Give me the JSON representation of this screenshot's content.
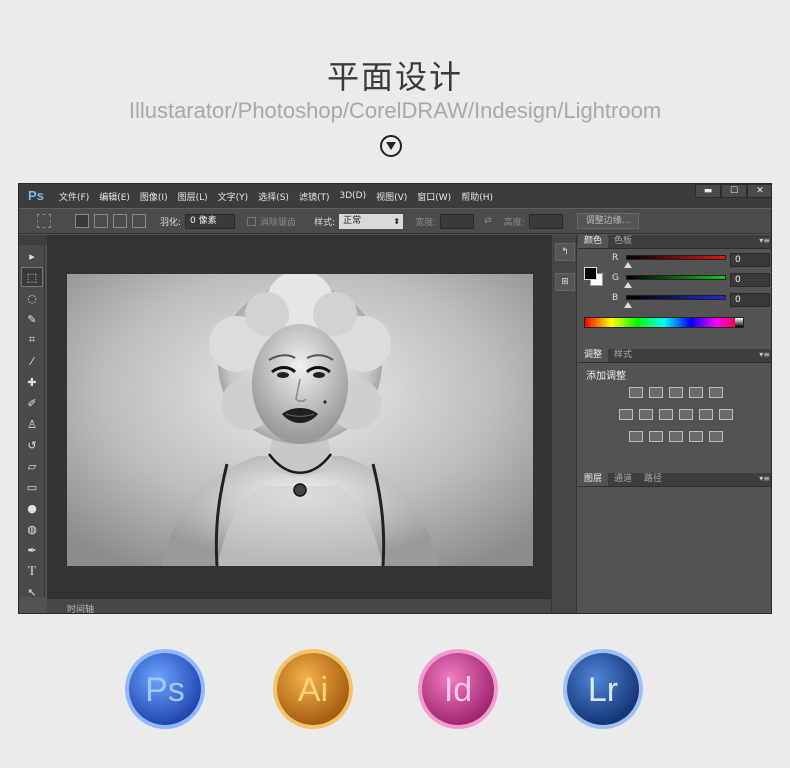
{
  "header": {
    "title": "平面设计",
    "subtitle": "Illustarator/Photoshop/CorelDRAW/Indesign/Lightroom"
  },
  "photoshop": {
    "logo": "Ps",
    "menu": [
      "文件(F)",
      "编辑(E)",
      "图像(I)",
      "图层(L)",
      "文字(Y)",
      "选择(S)",
      "滤镜(T)",
      "3D(D)",
      "视图(V)",
      "窗口(W)",
      "帮助(H)"
    ],
    "window_controls": [
      "▬",
      "☐",
      "✕"
    ],
    "options": {
      "feather_label": "羽化:",
      "feather_value": "0 像素",
      "antialias_label": "消除锯齿",
      "style_label": "样式:",
      "style_value": "正常",
      "width_label": "宽度:",
      "height_label": "高度:",
      "refine_button": "调整边缘..."
    },
    "timeline_label": "时间轴",
    "color_panel": {
      "tabs": [
        "颜色",
        "色板"
      ],
      "channels": [
        {
          "name": "R",
          "value": "0",
          "gradient": "#e11818"
        },
        {
          "name": "G",
          "value": "0",
          "gradient": "#18c818"
        },
        {
          "name": "B",
          "value": "0",
          "gradient": "#1830e0"
        }
      ]
    },
    "adjust_panel": {
      "tabs": [
        "调整",
        "样式"
      ],
      "title": "添加调整"
    },
    "layers_panel": {
      "tabs": [
        "图层",
        "通道",
        "路径"
      ]
    }
  },
  "apps": [
    {
      "label": "Ps",
      "color": "#2f6fe0",
      "rim": "#8fb8ff",
      "text": "#9ec8ff"
    },
    {
      "label": "Ai",
      "color": "#c87a16",
      "rim": "#f2c46a",
      "text": "#ffd27a"
    },
    {
      "label": "Id",
      "color": "#c8388e",
      "rim": "#f59ad0",
      "text": "#ffc7e8"
    },
    {
      "label": "Lr",
      "color": "#1e4aa0",
      "rim": "#9fc0f5",
      "text": "#d8e6ff"
    }
  ]
}
